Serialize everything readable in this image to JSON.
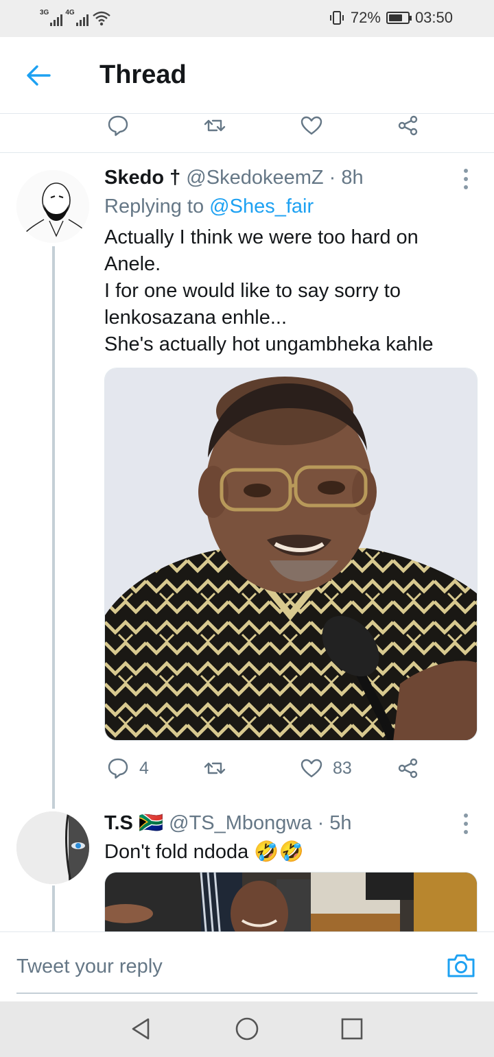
{
  "status_bar": {
    "net1": "3G",
    "net2": "4G",
    "battery_percent": "72%",
    "battery_level": 0.72,
    "time": "03:50"
  },
  "header": {
    "title": "Thread"
  },
  "colors": {
    "accent": "#1da1f2",
    "text_primary": "#14171a",
    "text_secondary": "#657786",
    "divider": "#e1e8ed",
    "thread_line": "#c4cfd6"
  },
  "tweets": [
    {
      "name": "Skedo †",
      "handle": "@SkedokeemZ · 8h",
      "replying_prefix": "Replying to ",
      "replying_to": "@Shes_fair",
      "lines": [
        "Actually I think we were too hard on",
        "Anele.",
        "I for one would like to say sorry to",
        "lenkosazana enhle...",
        "She's actually hot ungambheka kahle"
      ],
      "reply_count": "4",
      "like_count": "83"
    },
    {
      "name": "T.S",
      "flag": "🇿🇦",
      "handle": "@TS_Mbongwa · 5h",
      "text": "Don't fold ndoda",
      "emoji": "🤣🤣"
    }
  ],
  "reply_bar": {
    "placeholder": "Tweet your reply"
  }
}
